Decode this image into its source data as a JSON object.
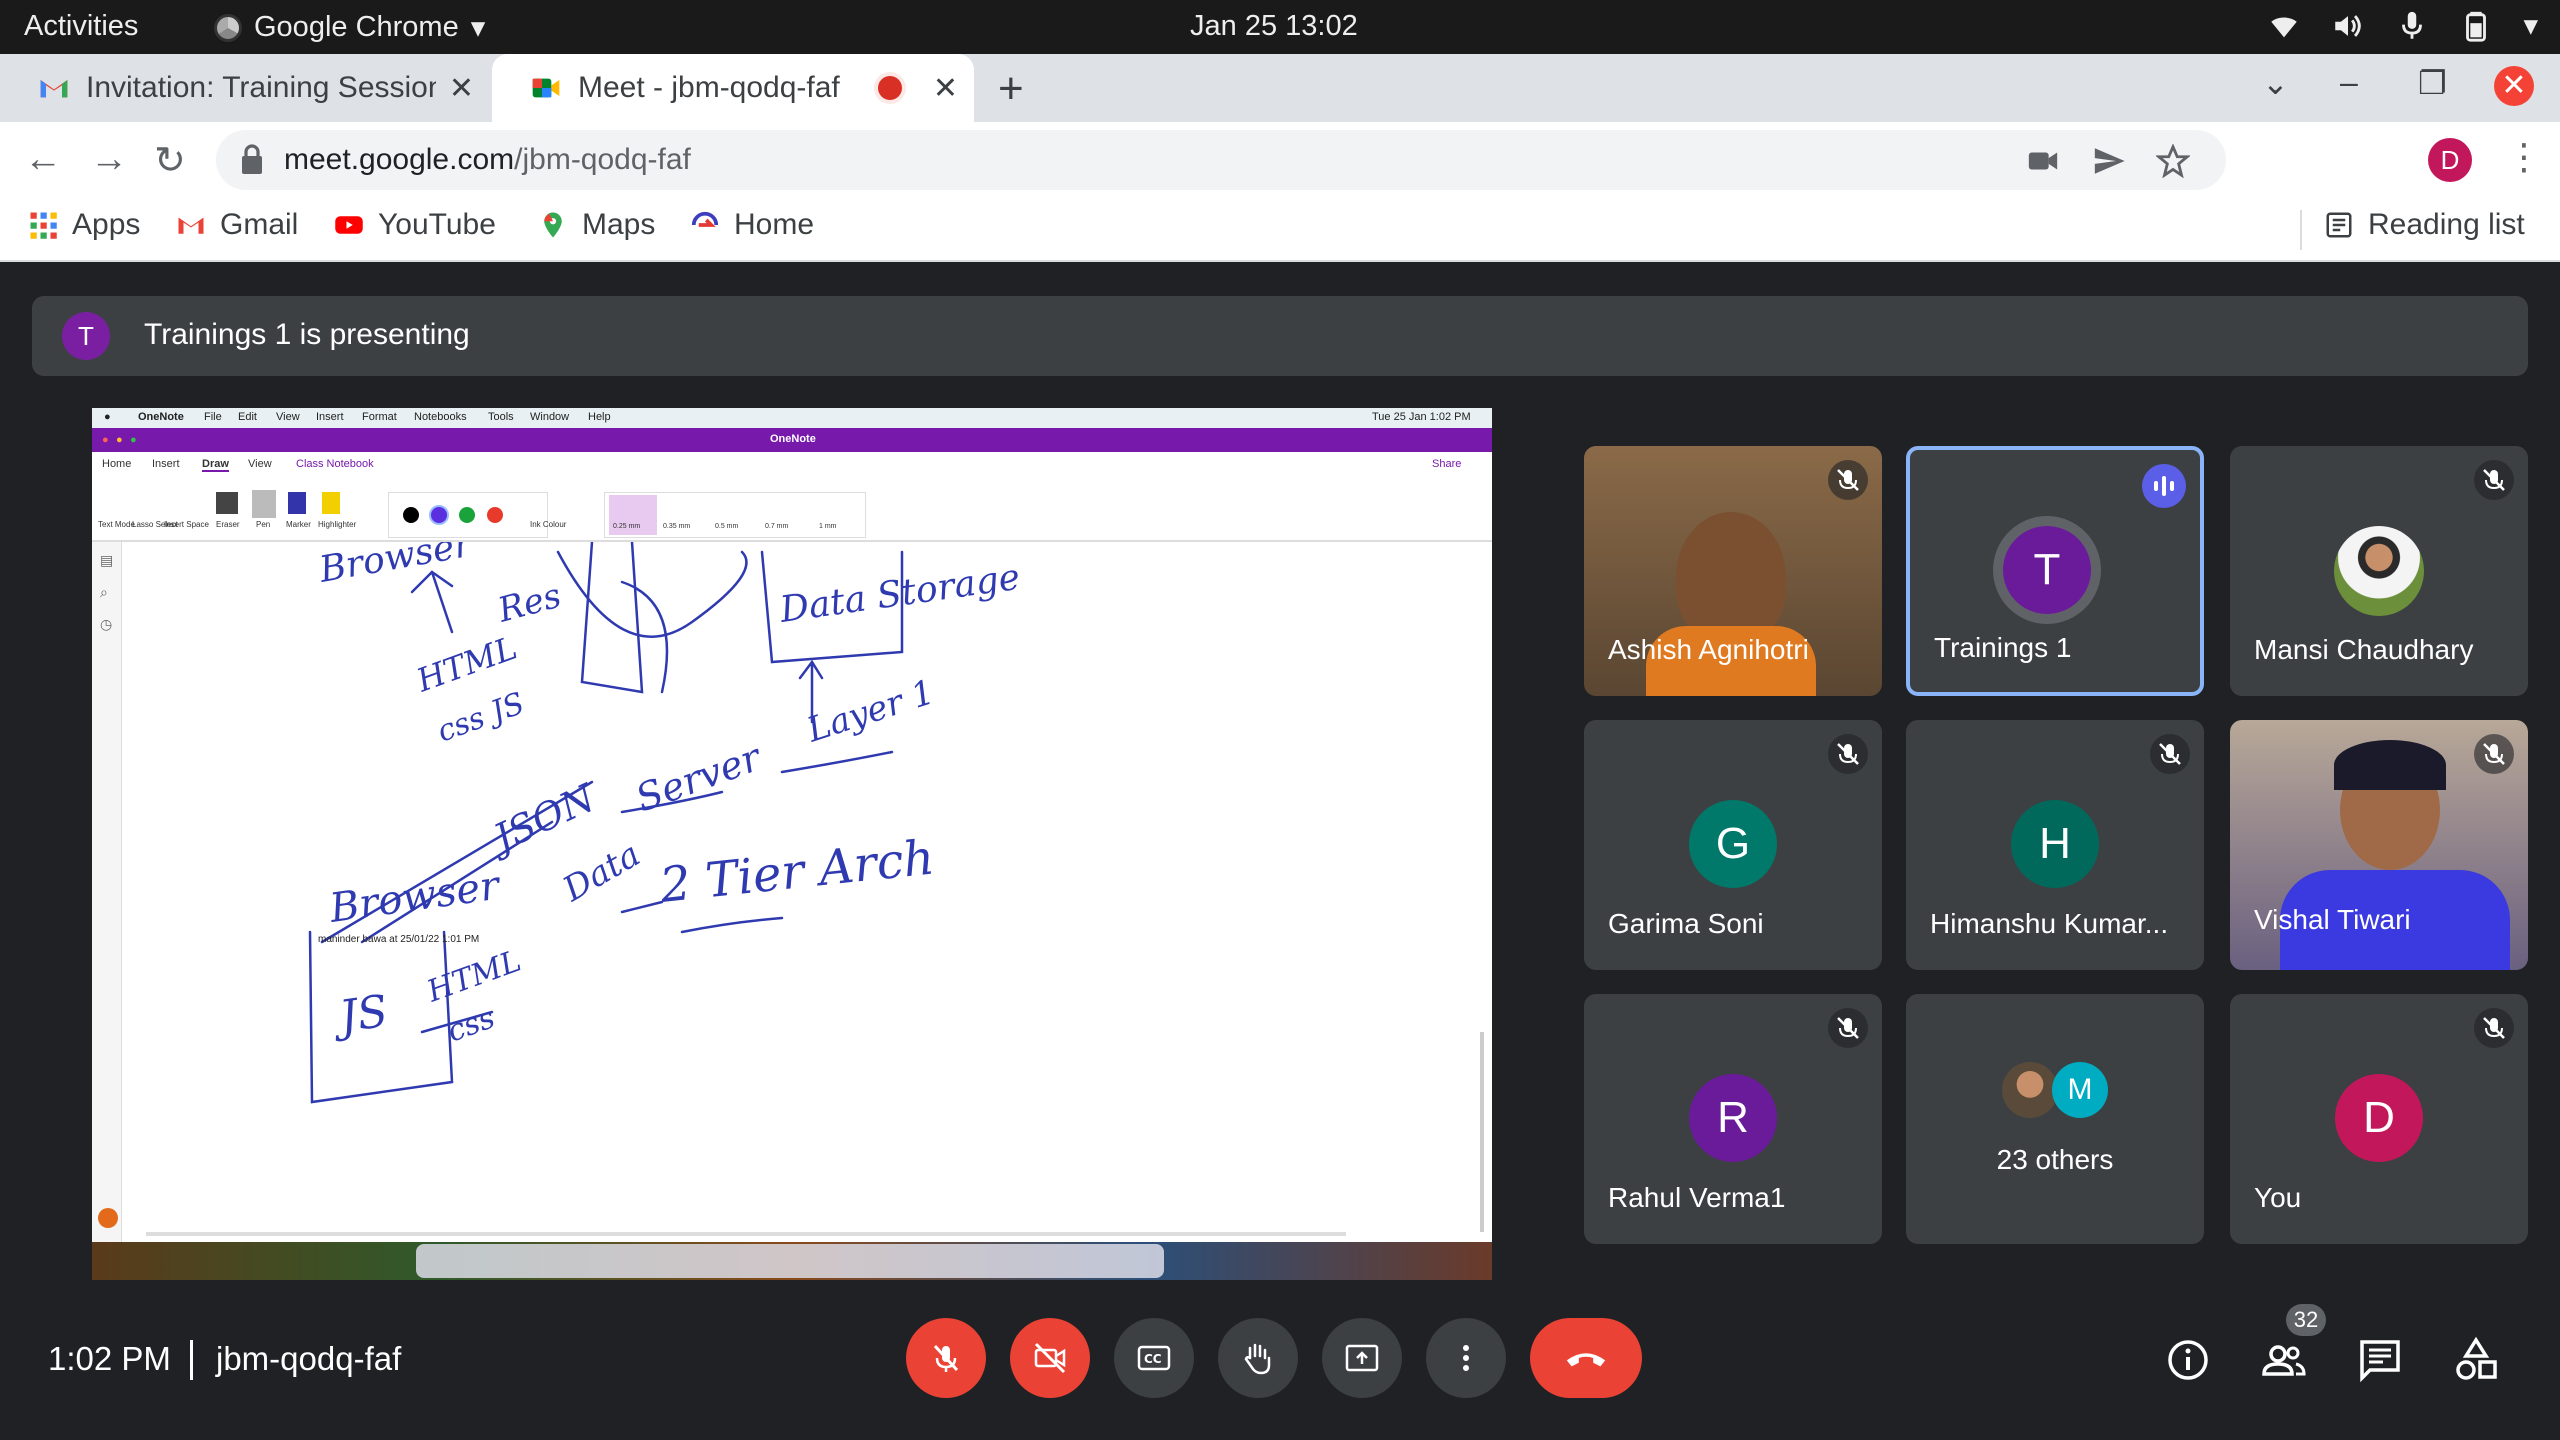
{
  "topbar": {
    "activities": "Activities",
    "app_name": "Google Chrome",
    "clock": "Jan 25  13:02"
  },
  "tabs": [
    {
      "title": "Invitation: Training Session",
      "icon": "gmail-icon"
    },
    {
      "title": "Meet - jbm-qodq-faf",
      "icon": "meet-icon"
    }
  ],
  "address": {
    "domain": "meet.google.com",
    "path": "/jbm-qodq-faf",
    "profile_initial": "D"
  },
  "bookmarks": [
    {
      "label": "Apps",
      "icon": "apps-grid-icon"
    },
    {
      "label": "Gmail",
      "icon": "gmail-icon"
    },
    {
      "label": "YouTube",
      "icon": "youtube-icon"
    },
    {
      "label": "Maps",
      "icon": "maps-icon"
    },
    {
      "label": "Home",
      "icon": "home-icon"
    }
  ],
  "reading_list": "Reading list",
  "meet": {
    "presenter_initial": "T",
    "presenting_text": "Trainings 1 is presenting",
    "participants": [
      {
        "name": "Ashish Agnihotri",
        "type": "video",
        "muted": true
      },
      {
        "name": "Trainings 1",
        "initial": "T",
        "color": "#6a1b9a",
        "speaking": true
      },
      {
        "name": "Mansi Chaudhary",
        "type": "photo",
        "muted": true
      },
      {
        "name": "Garima Soni",
        "initial": "G",
        "color": "#00796b",
        "muted": true
      },
      {
        "name": "Himanshu Kumar...",
        "initial": "H",
        "color": "#00695c",
        "muted": true
      },
      {
        "name": "Vishal Tiwari",
        "type": "video",
        "muted": true
      },
      {
        "name": "Rahul Verma1",
        "initial": "R",
        "color": "#6a1b9a",
        "muted": true
      },
      {
        "name": "23 others",
        "initial": "M",
        "color": "#00acc1"
      },
      {
        "name": "You",
        "initial": "D",
        "color": "#c2185b",
        "muted": true
      }
    ],
    "time": "1:02 PM",
    "code": "jbm-qodq-faf",
    "people_count": "32"
  },
  "shared_screen": {
    "app": "OneNote",
    "menu": [
      "OneNote",
      "File",
      "Edit",
      "View",
      "Insert",
      "Format",
      "Notebooks",
      "Tools",
      "Window",
      "Help"
    ],
    "menu_clock": "Tue 25 Jan  1:02 PM",
    "ribbon_tabs": [
      "Home",
      "Insert",
      "Draw",
      "View",
      "Class Notebook"
    ],
    "share": "Share",
    "tools": [
      "Text Mode",
      "Lasso Select",
      "Insert Space",
      "Eraser",
      "Pen",
      "Marker",
      "Highlighter"
    ],
    "ink_colour": "Ink Colour",
    "stroke_sizes": [
      "0.25 mm",
      "0.35 mm",
      "0.5 mm",
      "0.7 mm",
      "1 mm"
    ],
    "author_note": "maninder bawa at 25/01/22 1:01 PM",
    "handwriting": [
      "Browser",
      "Res",
      "HTML",
      "css JS",
      "Data Storage",
      "Layer 1",
      "Server",
      "JSON",
      "Data",
      "Browser",
      "2 Tier Arch",
      "JS",
      "HTML",
      "css"
    ]
  }
}
